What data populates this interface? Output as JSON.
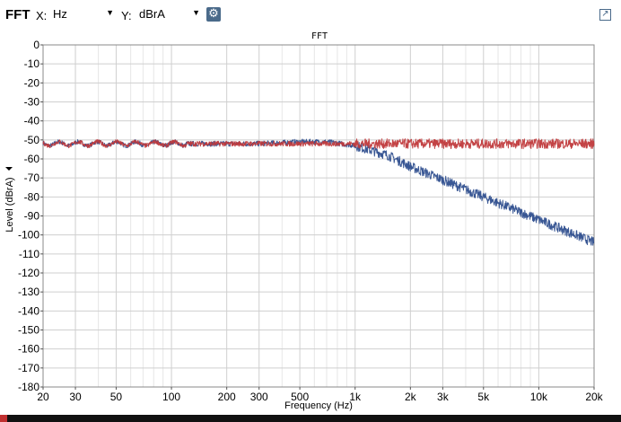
{
  "toolbar": {
    "title": "FFT",
    "x_label": "X:",
    "x_unit": "Hz",
    "y_label": "Y:",
    "y_unit": "dBrA",
    "settings_icon": "gear-icon",
    "popout_icon": "popout-icon"
  },
  "chart_data": {
    "type": "line",
    "title": "FFT",
    "xlabel": "Frequency (Hz)",
    "ylabel": "Level (dBrA)",
    "x_scale": "log",
    "xlim": [
      20,
      20000
    ],
    "ylim": [
      -180,
      0
    ],
    "x_ticks": [
      20,
      30,
      50,
      100,
      200,
      300,
      500,
      1000,
      2000,
      3000,
      5000,
      10000,
      20000
    ],
    "x_tick_labels": [
      "20",
      "30",
      "50",
      "100",
      "200",
      "300",
      "500",
      "1k",
      "2k",
      "3k",
      "5k",
      "10k",
      "20k"
    ],
    "y_ticks": [
      0,
      -10,
      -20,
      -30,
      -40,
      -50,
      -60,
      -70,
      -80,
      -90,
      -100,
      -110,
      -120,
      -130,
      -140,
      -150,
      -160,
      -170,
      -180
    ],
    "y_tick_labels": [
      "0",
      "-10",
      "-20",
      "-30",
      "-40",
      "-50",
      "-60",
      "-70",
      "-80",
      "-90",
      "-100",
      "-110",
      "-120",
      "-130",
      "-140",
      "-150",
      "-160",
      "-170",
      "-180"
    ],
    "grid": true,
    "series": [
      {
        "color": "#c0393b",
        "x": [
          20,
          30,
          50,
          100,
          200,
          300,
          500,
          700,
          1000,
          2000,
          3000,
          5000,
          10000,
          20000
        ],
        "values": [
          -52,
          -52,
          -52,
          -52,
          -52,
          -52,
          -52,
          -52,
          -52,
          -52,
          -52,
          -52,
          -52,
          -52
        ]
      },
      {
        "color": "#2e4e8e",
        "x": [
          20,
          30,
          50,
          100,
          200,
          300,
          500,
          700,
          1000,
          1500,
          2000,
          3000,
          5000,
          10000,
          20000
        ],
        "values": [
          -52,
          -52,
          -52,
          -52,
          -52,
          -52,
          -51,
          -51,
          -53,
          -58,
          -64,
          -71,
          -80,
          -92,
          -104
        ]
      }
    ]
  }
}
